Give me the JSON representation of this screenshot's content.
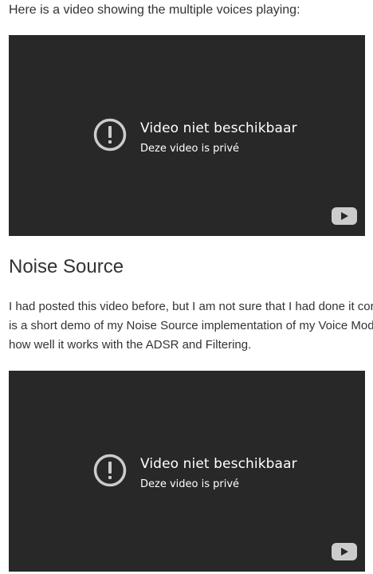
{
  "intro_text": "Here is a video showing the multiple voices playing:",
  "videos": [
    {
      "title": "Video niet beschikbaar",
      "subtitle": "Deze video is privé"
    },
    {
      "title": "Video niet beschikbaar",
      "subtitle": "Deze video is privé"
    }
  ],
  "section": {
    "heading": "Noise Source",
    "paragraph_lines": [
      "I had posted this video before, but I am not sure that I had done it corre",
      "is a short demo of my Noise Source implementation of my Voice Modu",
      "how well it works with the ADSR and Filtering."
    ]
  },
  "icons": {
    "warning": "exclamation-circle-icon",
    "play": "youtube-play-icon"
  },
  "colors": {
    "video_bg": "#282828",
    "text": "#333333",
    "overlay_text": "#ffffff",
    "icon_gray": "#cccccc"
  }
}
